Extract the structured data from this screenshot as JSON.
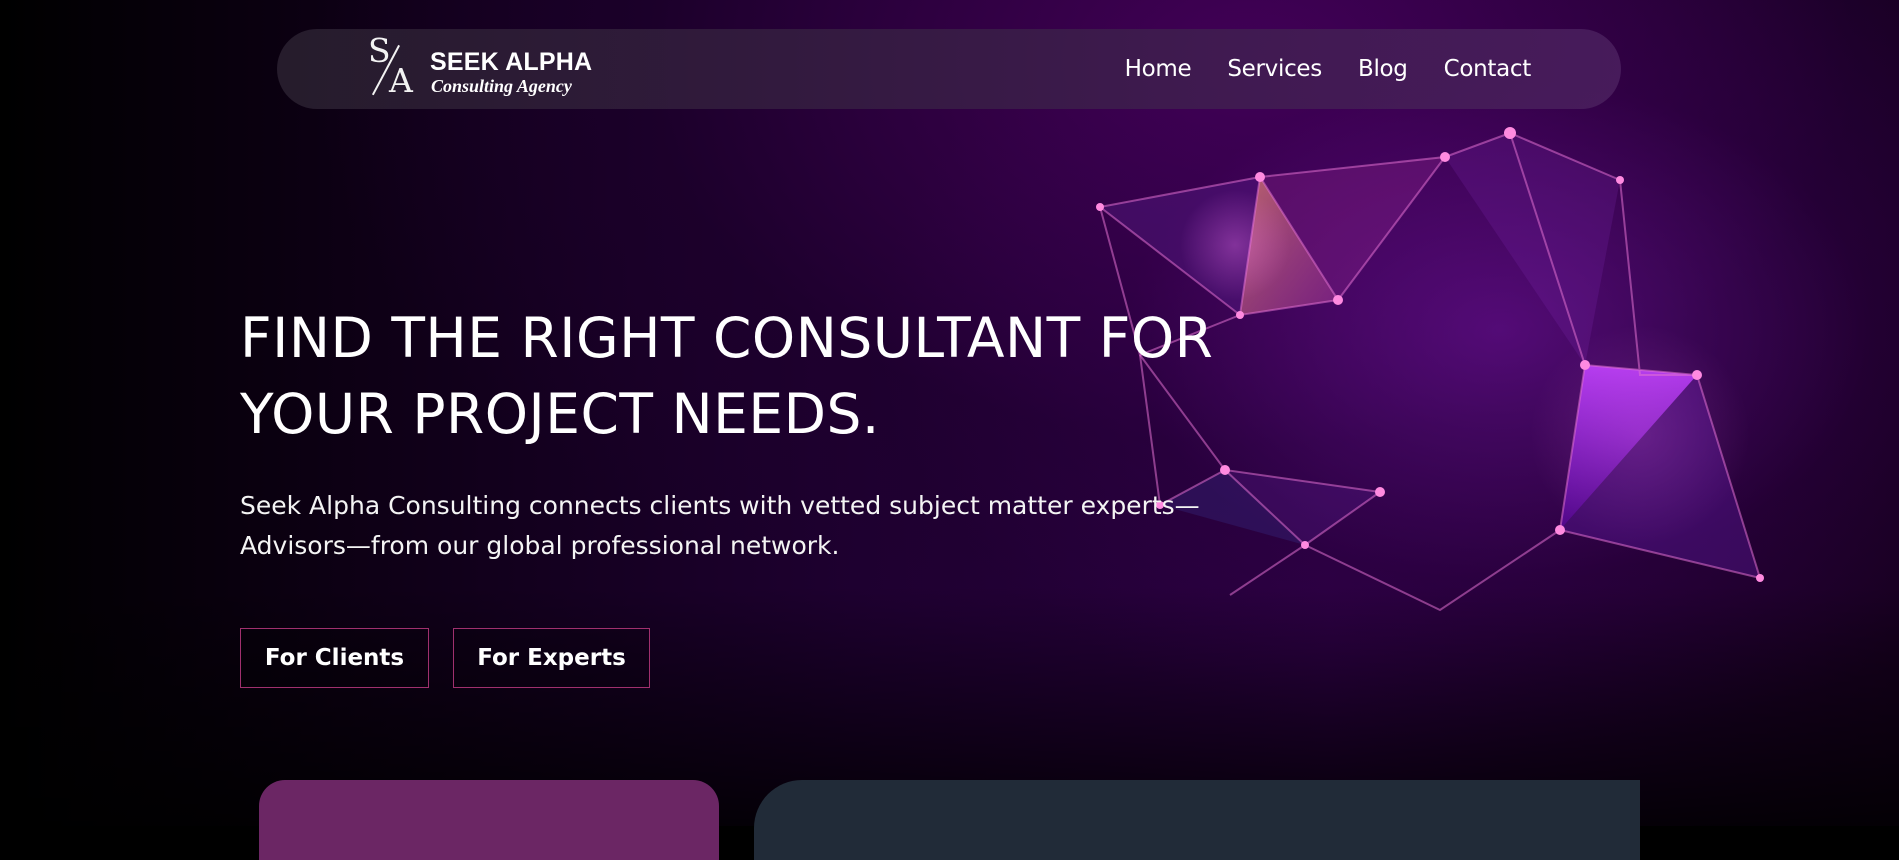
{
  "brand": {
    "mark_top": "S",
    "mark_bottom": "A",
    "name": "SEEK ALPHA",
    "tagline": "Consulting Agency"
  },
  "nav": {
    "links": [
      "Home",
      "Services",
      "Blog",
      "Contact"
    ]
  },
  "hero": {
    "heading_line1": "FIND THE RIGHT CONSULTANT FOR",
    "heading_line2": "YOUR PROJECT NEEDS.",
    "subtext_line1": "Seek Alpha Consulting connects clients with vetted subject matter experts—",
    "subtext_line2": "Advisors—from our global professional network.",
    "buttons": {
      "clients": "For Clients",
      "experts": "For Experts"
    }
  },
  "colors": {
    "accent_border": "#a0306e",
    "card_purple": "#6b2664",
    "card_slate": "#212b38",
    "glow_violet": "#a020f0"
  },
  "icons": {
    "logo": "sa-monogram-logo",
    "decoration": "polygon-network-graphic"
  }
}
